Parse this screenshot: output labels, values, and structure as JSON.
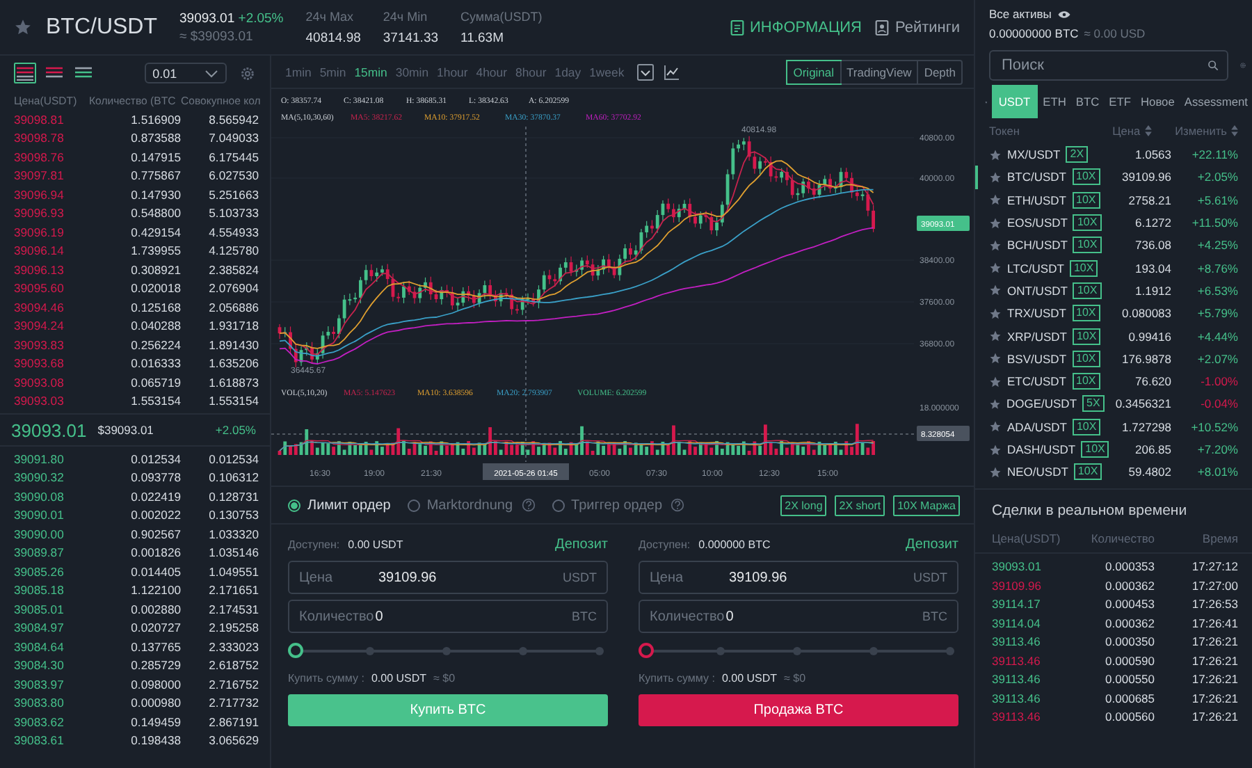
{
  "header": {
    "pair": "BTC/USDT",
    "price": "39093.01",
    "change": "+2.05%",
    "price_usd": "≈ $39093.01",
    "stats": [
      {
        "label": "24ч Max",
        "value": "40814.98"
      },
      {
        "label": "24ч Min",
        "value": "37141.33"
      },
      {
        "label": "Сумма(USDT)",
        "value": "11.63M"
      }
    ],
    "links": [
      {
        "kind": "info",
        "label": "ИНФОРМАЦИЯ",
        "selected": true
      },
      {
        "kind": "ratings",
        "label": "Рейтинги",
        "selected": false
      }
    ]
  },
  "order_book": {
    "views": [
      {
        "kind": "both",
        "selected": true
      },
      {
        "kind": "asks",
        "selected": false
      },
      {
        "kind": "bids",
        "selected": false
      }
    ],
    "precision": "0.01",
    "columns": [
      "Цена(USDT)",
      "Количество (BTC",
      "Совокупное кол"
    ],
    "asks": [
      [
        "39098.81",
        "1.516909",
        "8.565942"
      ],
      [
        "39098.78",
        "0.873588",
        "7.049033"
      ],
      [
        "39098.76",
        "0.147915",
        "6.175445"
      ],
      [
        "39097.81",
        "0.775867",
        "6.027530"
      ],
      [
        "39096.94",
        "0.147930",
        "5.251663"
      ],
      [
        "39096.93",
        "0.548800",
        "5.103733"
      ],
      [
        "39096.19",
        "0.429154",
        "4.554933"
      ],
      [
        "39096.14",
        "1.739955",
        "4.125780"
      ],
      [
        "39096.13",
        "0.308921",
        "2.385824"
      ],
      [
        "39095.60",
        "0.020018",
        "2.076904"
      ],
      [
        "39094.46",
        "0.125168",
        "2.056886"
      ],
      [
        "39094.24",
        "0.040288",
        "1.931718"
      ],
      [
        "39093.83",
        "0.256224",
        "1.891430"
      ],
      [
        "39093.68",
        "0.016333",
        "1.635206"
      ],
      [
        "39093.08",
        "0.065719",
        "1.618873"
      ],
      [
        "39093.03",
        "1.553154",
        "1.553154"
      ]
    ],
    "last_price": "39093.01",
    "last_price_usd": "$39093.01",
    "last_change": "+2.05%",
    "bids": [
      [
        "39091.80",
        "0.012534",
        "0.012534"
      ],
      [
        "39090.32",
        "0.093778",
        "0.106312"
      ],
      [
        "39090.08",
        "0.022419",
        "0.128731"
      ],
      [
        "39090.01",
        "0.002022",
        "0.130753"
      ],
      [
        "39090.00",
        "0.902567",
        "1.033320"
      ],
      [
        "39089.87",
        "0.001826",
        "1.035146"
      ],
      [
        "39085.26",
        "0.014405",
        "1.049551"
      ],
      [
        "39085.18",
        "1.122100",
        "2.171651"
      ],
      [
        "39085.01",
        "0.002880",
        "2.174531"
      ],
      [
        "39084.97",
        "0.020727",
        "2.195258"
      ],
      [
        "39084.64",
        "0.137765",
        "2.333023"
      ],
      [
        "39084.30",
        "0.285729",
        "2.618752"
      ],
      [
        "39083.97",
        "0.098000",
        "2.716752"
      ],
      [
        "39083.80",
        "0.000980",
        "2.717732"
      ],
      [
        "39083.62",
        "0.149459",
        "2.867191"
      ],
      [
        "39083.61",
        "0.198438",
        "3.065629"
      ]
    ]
  },
  "chart": {
    "intervals": [
      {
        "label": "1min",
        "selected": false
      },
      {
        "label": "5min",
        "selected": false
      },
      {
        "label": "15min",
        "selected": true
      },
      {
        "label": "30min",
        "selected": false
      },
      {
        "label": "1hour",
        "selected": false
      },
      {
        "label": "4hour",
        "selected": false
      },
      {
        "label": "8hour",
        "selected": false
      },
      {
        "label": "1day",
        "selected": false
      },
      {
        "label": "1week",
        "selected": false
      }
    ],
    "views": [
      {
        "label": "Original",
        "selected": true
      },
      {
        "label": "TradingView",
        "selected": false
      },
      {
        "label": "Depth",
        "selected": false
      }
    ],
    "ohlc": [
      "O: 38357.74",
      "C: 38421.08",
      "H: 38685.31",
      "L: 38342.63",
      "A: 6.202599"
    ],
    "ma_label": "MA(5,10,30,60)",
    "ma": [
      {
        "label": "MA5: 38217.62",
        "color": "#c8234e"
      },
      {
        "label": "MA10: 37917.52",
        "color": "#e0a030"
      },
      {
        "label": "MA30: 37870.37",
        "color": "#3aa0c8"
      },
      {
        "label": "MA60: 37702.92",
        "color": "#c21fc2"
      }
    ],
    "price_axis": [
      "40800.00",
      "40000.00",
      "38400.00",
      "37600.00",
      "36800.00"
    ],
    "current_price": "39093.01",
    "high": "40814.98",
    "low": "36445.67",
    "vol_label": "VOL(5,10,20)",
    "vol_ma": [
      {
        "label": "MA5: 5.147623",
        "color": "#c8234e"
      },
      {
        "label": "MA10: 3.638596",
        "color": "#e0a030"
      },
      {
        "label": "MA20: 2.793907",
        "color": "#3aa0c8"
      },
      {
        "label": "VOLUME: 6.202599",
        "color": "#45c08a"
      }
    ],
    "volume_axis": "18.000000",
    "volume_marker": "8.328054",
    "time_axis": [
      "16:30",
      "19:00",
      "21:30",
      "05:00",
      "07:30",
      "10:00",
      "12:30",
      "15:00"
    ],
    "crosshair_time": "2021-05-26 01:45"
  },
  "order_form": {
    "types": [
      {
        "label": "Лимит ордер",
        "selected": true,
        "help": false
      },
      {
        "label": "Marktordnung",
        "selected": false,
        "help": true
      },
      {
        "label": "Триггер ордер",
        "selected": false,
        "help": true
      }
    ],
    "modes": [
      "2X long",
      "2X short",
      "10X Маржа"
    ],
    "sides": [
      {
        "kind": "buy",
        "available_label": "Доступен:",
        "available": "0.00 USDT",
        "deposit": "Депозит",
        "price_label": "Цена",
        "price": "39109.96",
        "price_unit": "USDT",
        "amount_label": "Количество",
        "amount": "0",
        "amount_unit": "BTC",
        "level": 0,
        "total_label": "Купить сумму :",
        "total": "0.00 USDT",
        "total_usd": "≈ $0",
        "action": "Купить BTC"
      },
      {
        "kind": "sell",
        "available_label": "Доступен:",
        "available": "0.000000 BTC",
        "deposit": "Депозит",
        "price_label": "Цена",
        "price": "39109.96",
        "price_unit": "USDT",
        "amount_label": "Количество",
        "amount": "0",
        "amount_unit": "BTC",
        "level": 0,
        "total_label": "Купить сумму :",
        "total": "0.00 USDT",
        "total_usd": "≈ $0",
        "action": "Продажа BTC"
      }
    ]
  },
  "assets": {
    "title": "Все активы",
    "balance": "0.00000000 BTC",
    "balance_usd": "≈ 0.00 USD"
  },
  "market": {
    "search": {
      "placeholder": "Поиск"
    },
    "tabs": [
      {
        "label": "USDT",
        "selected": true
      },
      {
        "label": "ETH",
        "selected": false
      },
      {
        "label": "BTC",
        "selected": false
      },
      {
        "label": "ETF",
        "selected": false
      },
      {
        "label": "Новое",
        "selected": false
      },
      {
        "label": "Assessment",
        "selected": false
      }
    ],
    "columns": [
      "Токен",
      "Цена",
      "Изменить"
    ],
    "rows": [
      {
        "pair": "MX/USDT",
        "leverage": "2X",
        "price": "1.0563",
        "change": "+22.11%",
        "falling": false,
        "selected": false
      },
      {
        "pair": "BTC/USDT",
        "leverage": "10X",
        "price": "39109.96",
        "change": "+2.05%",
        "falling": false,
        "selected": true
      },
      {
        "pair": "ETH/USDT",
        "leverage": "10X",
        "price": "2758.21",
        "change": "+5.61%",
        "falling": false,
        "selected": false
      },
      {
        "pair": "EOS/USDT",
        "leverage": "10X",
        "price": "6.1272",
        "change": "+11.50%",
        "falling": false,
        "selected": false
      },
      {
        "pair": "BCH/USDT",
        "leverage": "10X",
        "price": "736.08",
        "change": "+4.25%",
        "falling": false,
        "selected": false
      },
      {
        "pair": "LTC/USDT",
        "leverage": "10X",
        "price": "193.04",
        "change": "+8.76%",
        "falling": false,
        "selected": false
      },
      {
        "pair": "ONT/USDT",
        "leverage": "10X",
        "price": "1.1912",
        "change": "+6.53%",
        "falling": false,
        "selected": false
      },
      {
        "pair": "TRX/USDT",
        "leverage": "10X",
        "price": "0.080083",
        "change": "+5.79%",
        "falling": false,
        "selected": false
      },
      {
        "pair": "XRP/USDT",
        "leverage": "10X",
        "price": "0.99416",
        "change": "+4.44%",
        "falling": false,
        "selected": false
      },
      {
        "pair": "BSV/USDT",
        "leverage": "10X",
        "price": "176.9878",
        "change": "+2.07%",
        "falling": false,
        "selected": false
      },
      {
        "pair": "ETC/USDT",
        "leverage": "10X",
        "price": "76.620",
        "change": "-1.00%",
        "falling": true,
        "selected": false
      },
      {
        "pair": "DOGE/USDT",
        "leverage": "5X",
        "price": "0.3456321",
        "change": "-0.04%",
        "falling": true,
        "selected": false
      },
      {
        "pair": "ADA/USDT",
        "leverage": "10X",
        "price": "1.727298",
        "change": "+10.52%",
        "falling": false,
        "selected": false
      },
      {
        "pair": "DASH/USDT",
        "leverage": "10X",
        "price": "206.85",
        "change": "+7.20%",
        "falling": false,
        "selected": false
      },
      {
        "pair": "NEO/USDT",
        "leverage": "10X",
        "price": "59.4802",
        "change": "+8.01%",
        "falling": false,
        "selected": false
      }
    ]
  },
  "trades": {
    "title": "Сделки в реальном времени",
    "columns": [
      "Цена(USDT)",
      "Количество",
      "Время"
    ],
    "rows": [
      {
        "price": "39093.01",
        "amount": "0.000353",
        "time": "17:27:12",
        "sell": false
      },
      {
        "price": "39109.96",
        "amount": "0.000362",
        "time": "17:27:00",
        "sell": true
      },
      {
        "price": "39114.17",
        "amount": "0.000453",
        "time": "17:26:53",
        "sell": false
      },
      {
        "price": "39114.04",
        "amount": "0.000362",
        "time": "17:26:41",
        "sell": false
      },
      {
        "price": "39113.46",
        "amount": "0.000350",
        "time": "17:26:21",
        "sell": false
      },
      {
        "price": "39113.46",
        "amount": "0.000590",
        "time": "17:26:21",
        "sell": true
      },
      {
        "price": "39113.46",
        "amount": "0.000550",
        "time": "17:26:21",
        "sell": false
      },
      {
        "price": "39113.46",
        "amount": "0.000685",
        "time": "17:26:21",
        "sell": false
      },
      {
        "price": "39113.46",
        "amount": "0.000560",
        "time": "17:26:21",
        "sell": true
      }
    ]
  }
}
